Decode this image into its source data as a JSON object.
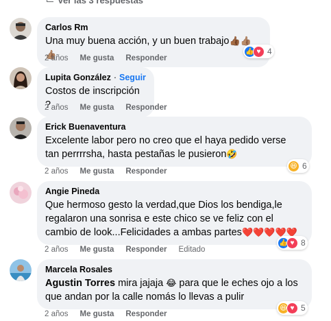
{
  "top": {
    "view_replies": "Ver las 3 respuestas"
  },
  "comments": [
    {
      "author": "Carlos Rm",
      "text": "Una muy buena acción, y un buen trabajo",
      "emoji": "👍🏾👍🏽👍🏽",
      "time": "2 años",
      "like": "Me gusta",
      "reply": "Responder",
      "reactions": [
        "like",
        "love"
      ],
      "reaction_count": "4"
    },
    {
      "author": "Lupita González",
      "follow": "Seguir",
      "separator": "·",
      "text": "Costos de inscripción ?",
      "time": "2 años",
      "like": "Me gusta",
      "reply": "Responder"
    },
    {
      "author": "Erick Buenaventura",
      "text": "Excelente labor pero no creo que el haya pedido verse\ntan perrrrsha, hasta pestañas le pusieron",
      "emoji": "🤣",
      "time": "2 años",
      "like": "Me gusta",
      "reply": "Responder",
      "reactions": [
        "haha"
      ],
      "reaction_count": "6"
    },
    {
      "author": "Angie Pineda",
      "text": "Que hermoso gesto la verdad,que Dios los bendiga,le\nregalaron una sonrisa e este chico se ve feliz con el\ncambio de look...Felicidades a ambas partes",
      "emoji": "❤️❤️❤️❤️❤️",
      "time": "2 años",
      "like": "Me gusta",
      "reply": "Responder",
      "edited": "Editado",
      "reactions": [
        "like",
        "love"
      ],
      "reaction_count": "8"
    },
    {
      "author": "Marcela Rosales",
      "mention": "Agustin Torres",
      "text_a": " mira jajaja ",
      "emoji_a": "😂",
      "text_b": " para que le eches ojo a los\nque andan por la calle nomás lo llevas a pulir",
      "time": "2 años",
      "like": "Me gusta",
      "reply": "Responder",
      "reactions": [
        "haha",
        "love"
      ],
      "reaction_count": "5"
    }
  ],
  "colors": {
    "link_blue": "#1877f2",
    "bubble_bg": "#f0f2f5",
    "meta_gray": "#65676b",
    "like_blue": "#1877f2",
    "love_red": "#f33e58",
    "haha_yellow": "#f7b125"
  }
}
